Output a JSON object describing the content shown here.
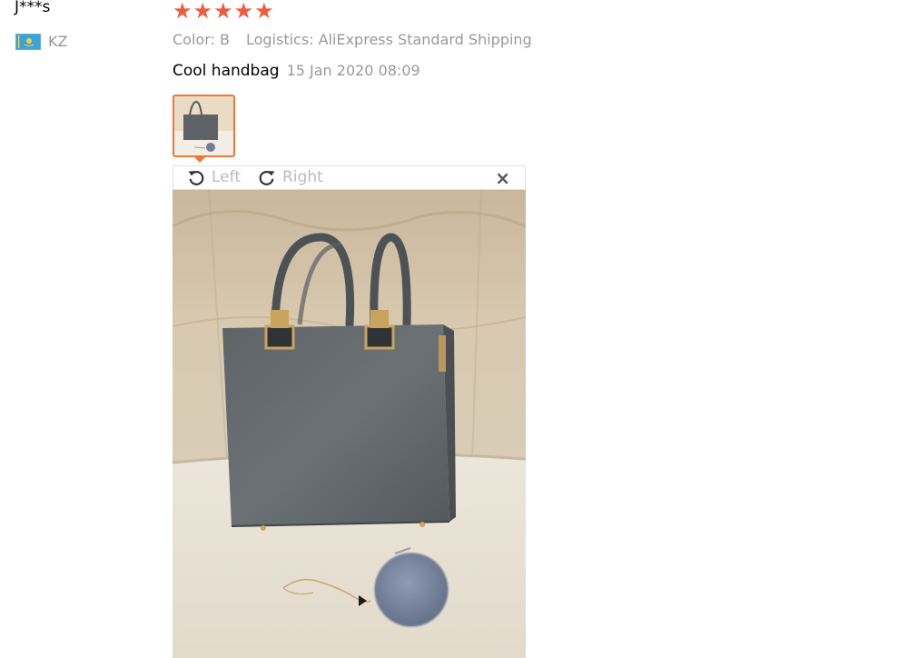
{
  "review": {
    "user_name": "J***s",
    "country_code": "KZ",
    "flag_icon": "kazakhstan-flag-icon",
    "rating": 5,
    "color_text": "Color: B",
    "logistics_text": "Logistics: AliExpress Standard Shipping",
    "comment": "Cool handbag",
    "date": "15 Jan 2020 08:09"
  },
  "viewer": {
    "rotate_left_label": "Left",
    "rotate_right_label": "Right",
    "close_glyph": "×",
    "rotate_left_icon": "rotate-left-icon",
    "rotate_right_icon": "rotate-right-icon"
  },
  "colors": {
    "star": "#f05a3c",
    "accent": "#f07838",
    "muted_text": "#999999"
  }
}
